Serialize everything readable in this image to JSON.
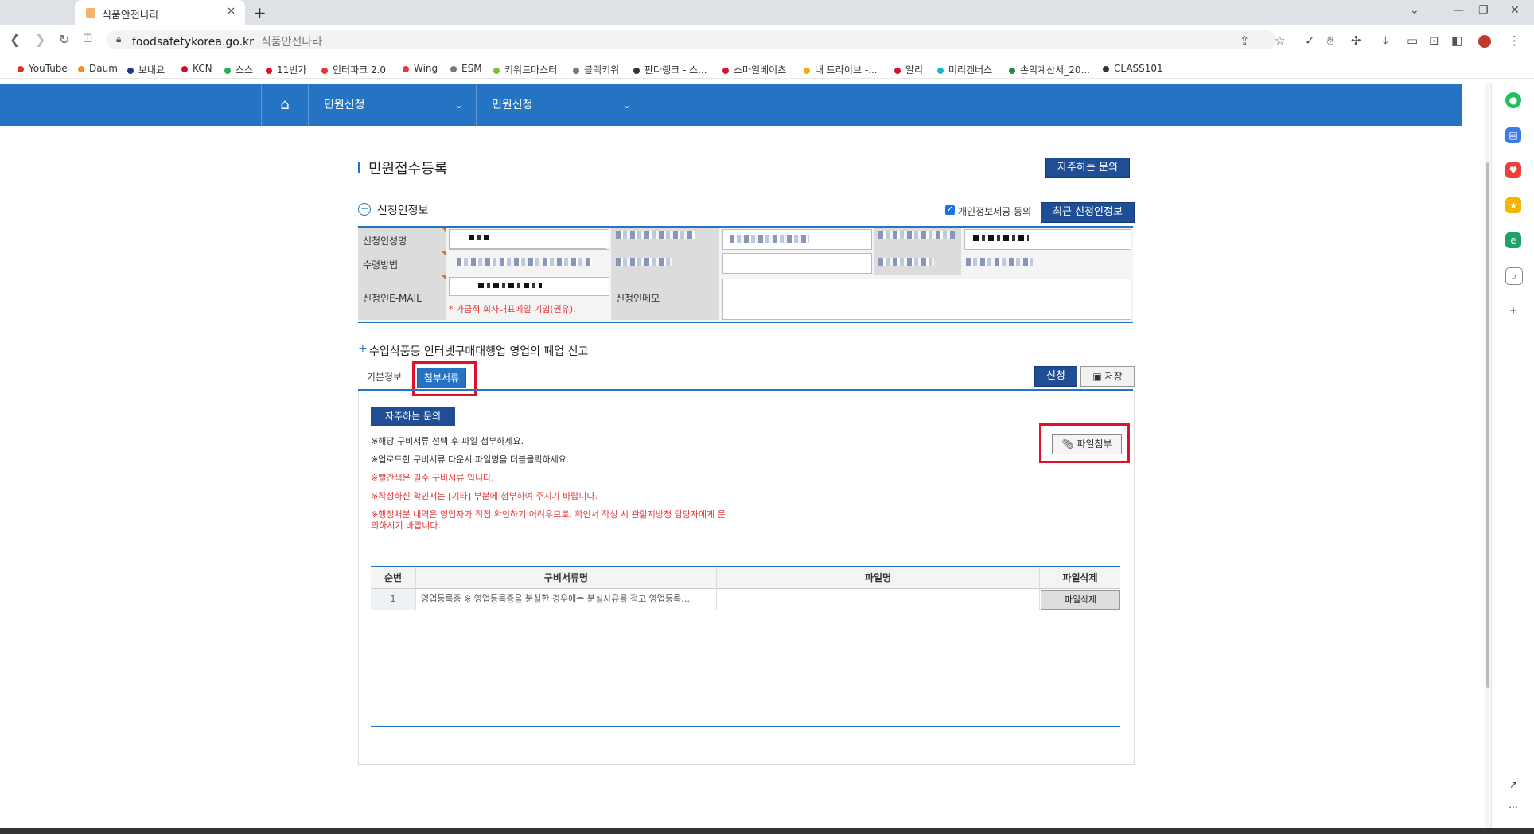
{
  "browser": {
    "tab_title": "식품안전나라",
    "new_tab": "+",
    "url_domain": "foodsafetykorea.go.kr",
    "url_title": "식품안전나라"
  },
  "bookmarks": [
    {
      "label": "YouTube",
      "color": "#e52d27"
    },
    {
      "label": "Daum",
      "color": "#f58c1f"
    },
    {
      "label": "보내요",
      "color": "#1a3a8f"
    },
    {
      "label": "KCN",
      "color": "#d0102a"
    },
    {
      "label": "스스",
      "color": "#1fb34a"
    },
    {
      "label": "11번가",
      "color": "#e0102a"
    },
    {
      "label": "인터파크 2.0",
      "color": "#e03a3a"
    },
    {
      "label": "Wing",
      "color": "#e03a3a"
    },
    {
      "label": "ESM",
      "color": "#777777"
    },
    {
      "label": "키워드마스터",
      "color": "#7bbf3a"
    },
    {
      "label": "블랙키위",
      "color": "#777777"
    },
    {
      "label": "판다랭크 - 스...",
      "color": "#333333"
    },
    {
      "label": "스마일베이츠",
      "color": "#e0102a"
    },
    {
      "label": "내 드라이브 -...",
      "color": "#f5a623"
    },
    {
      "label": "알리",
      "color": "#e0102a"
    },
    {
      "label": "미리캔버스",
      "color": "#1fb3c4"
    },
    {
      "label": "손익계산서_20...",
      "color": "#1f8a4c"
    },
    {
      "label": "CLASS101",
      "color": "#333333"
    }
  ],
  "site_nav": {
    "home_icon": "home-icon",
    "menu1": "민원신청",
    "menu2": "민원신청"
  },
  "page": {
    "title": "민원접수등록",
    "faq_button": "자주하는 문의",
    "applicant_section_title": "신청인정보",
    "privacy_consent_label": "개인정보제공 동의",
    "privacy_consent_checked": true,
    "recent_info_button": "최근 신청인정보",
    "labels": {
      "name": "신청인성명",
      "receive_method": "수령방법",
      "email": "신청인E-MAIL",
      "memo": "신청인메모"
    },
    "email_note": "* 가급적 회사대표메일 기입(권유).",
    "sub_title": "수입식품등 인터넷구매대행업 영업의 폐업 신고",
    "tabs": [
      "기본정보",
      "첨부서류"
    ],
    "active_tab": "첨부서류",
    "submit_button": "신청",
    "save_button": "저장",
    "attach_faq_button": "자주하는 문의",
    "notes": [
      {
        "text": "※해당 구비서류 선택 후 파일 첨부하세요.",
        "red": false
      },
      {
        "text": "※업로드한 구비서류 다운시 파일명을 더블클릭하세요.",
        "red": false
      },
      {
        "text": "※빨간색은 필수 구비서류 입니다.",
        "red": true
      },
      {
        "text": "※작성하신 확인서는 [기타] 부분에 첨부하여 주시기 바랍니다.",
        "red": true
      },
      {
        "text": "※행정처분 내역은 영업자가 직접 확인하기 어려우므로, 확인서 작성 시 관할지방청 담당자에게 문",
        "red": true
      },
      {
        "text": "의하시기 바랍니다.",
        "red": true
      }
    ],
    "file_attach_button": "파일첨부",
    "table": {
      "headers": [
        "순번",
        "구비서류명",
        "파일명",
        "파일삭제"
      ],
      "rows": [
        {
          "no": "1",
          "doc": "영업등록증 ※ 영업등록증을 분실한 경우에는 분실사유를 적고 영업등록…",
          "file": "",
          "delete": "파일삭제"
        }
      ]
    }
  },
  "colors": {
    "nav_blue": "#2574c4",
    "button_navy": "#1f4e96",
    "highlight_red": "#e0102a",
    "note_red": "#e03a3a"
  }
}
